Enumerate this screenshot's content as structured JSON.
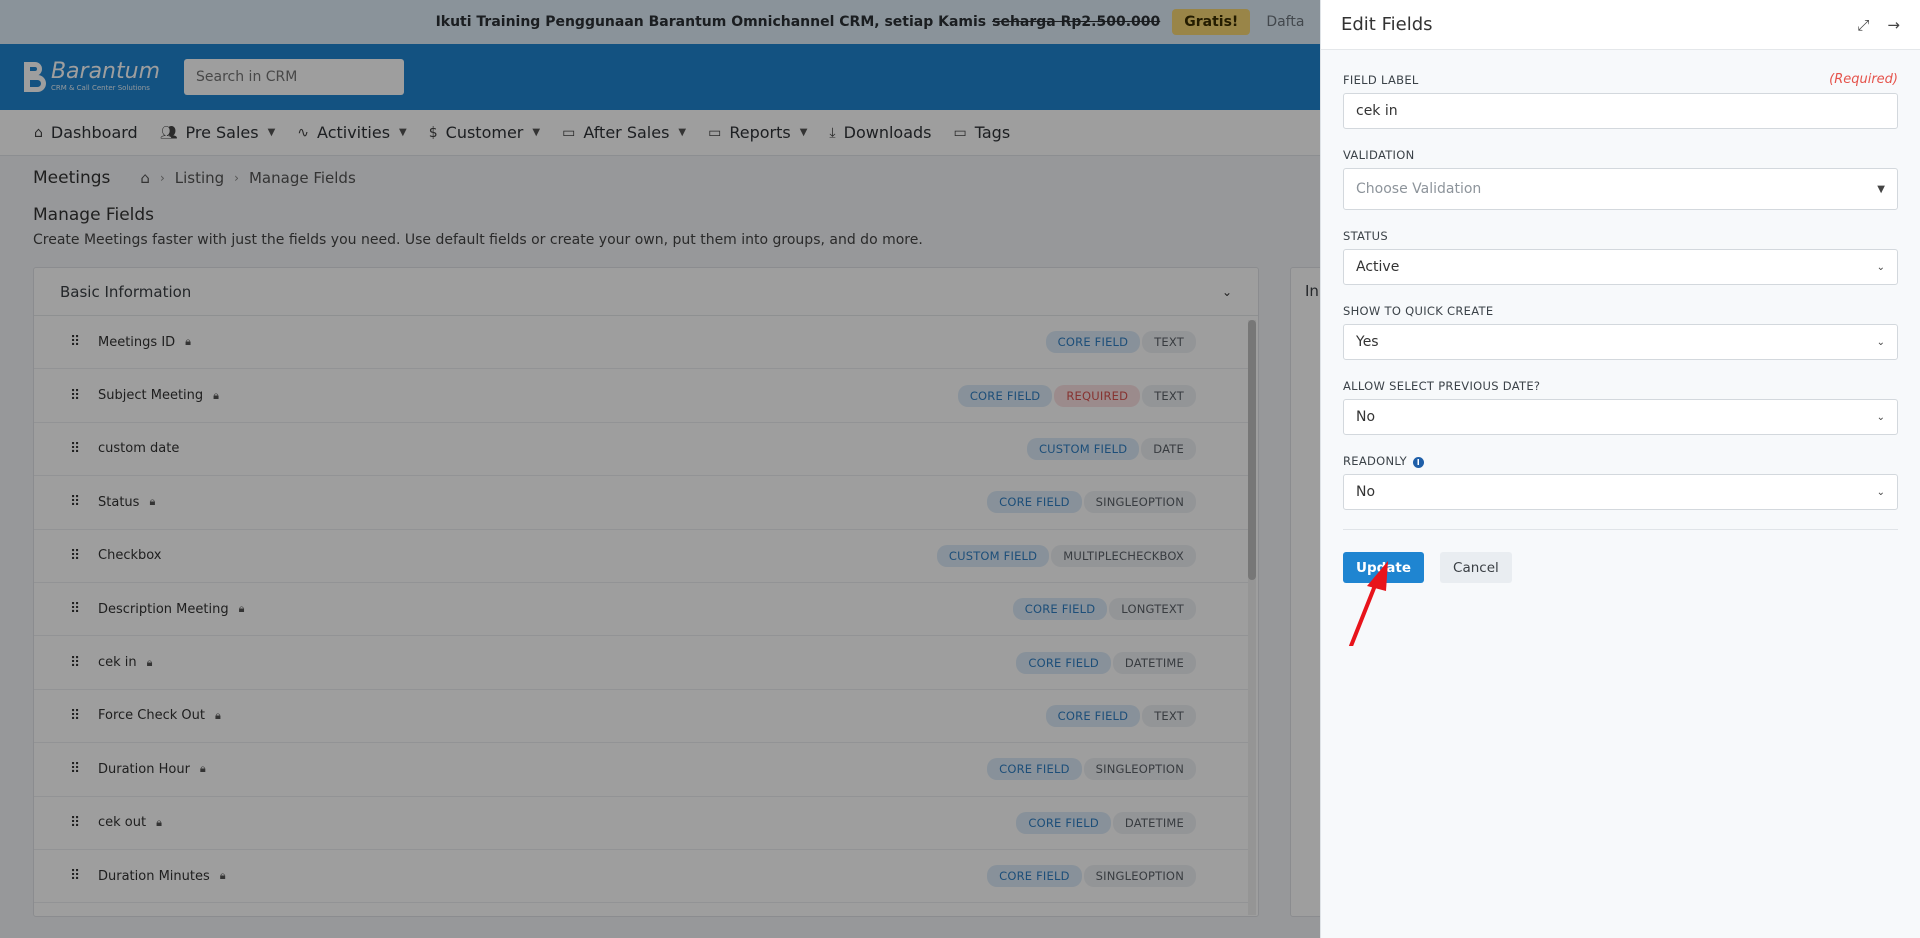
{
  "banner": {
    "text": "Ikuti Training Penggunaan Barantum Omnichannel CRM, setiap Kamis",
    "strike_price": "seharga Rp2.500.000",
    "badge": "Gratis!",
    "trailing": "Dafta"
  },
  "header": {
    "logo_name": "Barantum",
    "logo_tagline": "CRM & Call Center Solutions",
    "search_placeholder": "Search in CRM"
  },
  "nav": {
    "items": [
      {
        "label": "Dashboard",
        "icon": "home-icon"
      },
      {
        "label": "Pre Sales",
        "icon": "users-icon"
      },
      {
        "label": "Activities",
        "icon": "activity-icon"
      },
      {
        "label": "Customer",
        "icon": "dollar-icon"
      },
      {
        "label": "After Sales",
        "icon": "folder-icon"
      },
      {
        "label": "Reports",
        "icon": "folder-icon"
      },
      {
        "label": "Downloads",
        "icon": "download-icon"
      },
      {
        "label": "Tags",
        "icon": "folder-icon"
      }
    ]
  },
  "breadcrumb": {
    "title": "Meetings",
    "listing": "Listing",
    "current": "Manage Fields"
  },
  "section": {
    "title": "Manage Fields",
    "description": "Create Meetings faster with just the fields you need. Use default fields or create your own, put them into groups, and do more."
  },
  "basic_card": {
    "title": "Basic Information",
    "rows": [
      {
        "name": "Meetings ID",
        "locked": true,
        "tags": [
          "CORE FIELD",
          "TEXT"
        ]
      },
      {
        "name": "Subject Meeting",
        "locked": true,
        "tags": [
          "CORE FIELD",
          "REQUIRED",
          "TEXT"
        ]
      },
      {
        "name": "custom date",
        "locked": false,
        "tags": [
          "CUSTOM FIELD",
          "DATE"
        ]
      },
      {
        "name": "Status",
        "locked": true,
        "tags": [
          "CORE FIELD",
          "SINGLEOPTION"
        ]
      },
      {
        "name": "Checkbox",
        "locked": false,
        "tags": [
          "CUSTOM FIELD",
          "MULTIPLECHECKBOX"
        ]
      },
      {
        "name": "Description Meeting",
        "locked": true,
        "tags": [
          "CORE FIELD",
          "LONGTEXT"
        ]
      },
      {
        "name": "cek in",
        "locked": true,
        "tags": [
          "CORE FIELD",
          "DATETIME"
        ]
      },
      {
        "name": "Force Check Out",
        "locked": true,
        "tags": [
          "CORE FIELD",
          "TEXT"
        ]
      },
      {
        "name": "Duration Hour",
        "locked": true,
        "tags": [
          "CORE FIELD",
          "SINGLEOPTION"
        ]
      },
      {
        "name": "cek out",
        "locked": true,
        "tags": [
          "CORE FIELD",
          "DATETIME"
        ]
      },
      {
        "name": "Duration Minutes",
        "locked": true,
        "tags": [
          "CORE FIELD",
          "SINGLEOPTION"
        ]
      }
    ]
  },
  "second_card": {
    "title_partial": "In"
  },
  "drawer": {
    "title": "Edit Fields",
    "field_label": {
      "label": "FIELD LABEL",
      "required": "(Required)",
      "value": "cek in"
    },
    "validation": {
      "label": "VALIDATION",
      "placeholder": "Choose Validation"
    },
    "status": {
      "label": "STATUS",
      "value": "Active"
    },
    "quick_create": {
      "label": "SHOW TO QUICK CREATE",
      "value": "Yes"
    },
    "prev_date": {
      "label": "ALLOW SELECT PREVIOUS DATE?",
      "value": "No"
    },
    "readonly": {
      "label": "READONLY",
      "value": "No"
    },
    "update_label": "Update",
    "cancel_label": "Cancel"
  },
  "colors": {
    "brand": "#1f85d1",
    "required": "#e5534b",
    "annotation_arrow": "#e8141b"
  }
}
